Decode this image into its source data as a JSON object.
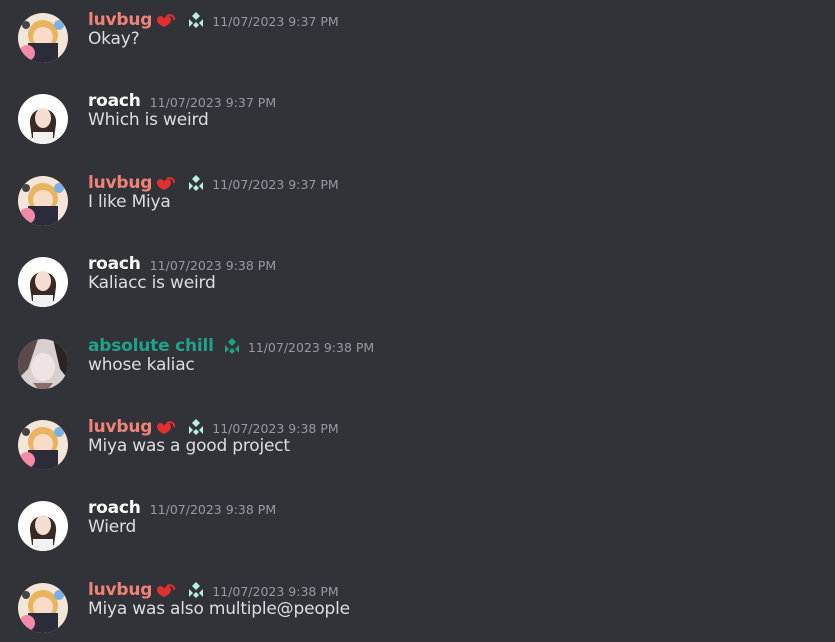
{
  "colors": {
    "background": "#313338",
    "luvbug": "#f0827a",
    "roach": "#ffffff",
    "absolute_chill": "#1fa287",
    "timestamp": "#949ba4",
    "message_text": "#dbdee1",
    "badge": "#b8f0dc",
    "role_icon": "#e03030"
  },
  "messages": [
    {
      "author": "luvbug",
      "timestamp": "11/07/2023 9:37 PM",
      "text": "Okay?"
    },
    {
      "author": "roach",
      "timestamp": "11/07/2023 9:37 PM",
      "text": "Which is weird"
    },
    {
      "author": "luvbug",
      "timestamp": "11/07/2023 9:37 PM",
      "text": "I like Miya"
    },
    {
      "author": "roach",
      "timestamp": "11/07/2023 9:38 PM",
      "text": "Kaliacc is weird"
    },
    {
      "author": "absolute chill",
      "timestamp": "11/07/2023 9:38 PM",
      "text": "whose kaliac"
    },
    {
      "author": "luvbug",
      "timestamp": "11/07/2023 9:38 PM",
      "text": "Miya was a good project"
    },
    {
      "author": "roach",
      "timestamp": "11/07/2023 9:38 PM",
      "text": "Wierd"
    },
    {
      "author": "luvbug",
      "timestamp": "11/07/2023 9:38 PM",
      "text": "Miya was also multiple@people"
    }
  ],
  "icons": {
    "role": "red-heart-chain-icon",
    "badge": "server-boost-badge-icon"
  }
}
